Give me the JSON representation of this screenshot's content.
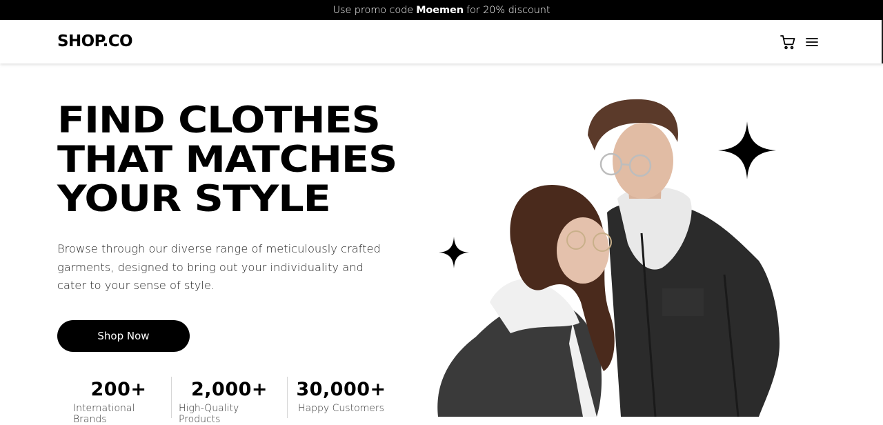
{
  "promo": {
    "prefix": "Use promo code",
    "code": "Moemen",
    "suffix": "for 20% discount"
  },
  "header": {
    "logo": "SHOP.CO",
    "icons": [
      "cart-icon",
      "menu-icon"
    ]
  },
  "hero": {
    "title_lines": [
      "FIND CLOTHES",
      "THAT MATCHES",
      "YOUR STYLE"
    ],
    "description": "Browse through our diverse range of meticulously crafted garments, designed to bring out your individuality and cater to your sense of style.",
    "cta_label": "Shop Now"
  },
  "stats": [
    {
      "value": "200+",
      "label": "International Brands"
    },
    {
      "value": "2,000+",
      "label": "High-Quality Products"
    },
    {
      "value": "30,000+",
      "label": "Happy Customers"
    }
  ],
  "colors": {
    "promo_bg": "#000000",
    "button_bg": "#000000",
    "text": "#000000",
    "page_bg": "#ffffff"
  }
}
